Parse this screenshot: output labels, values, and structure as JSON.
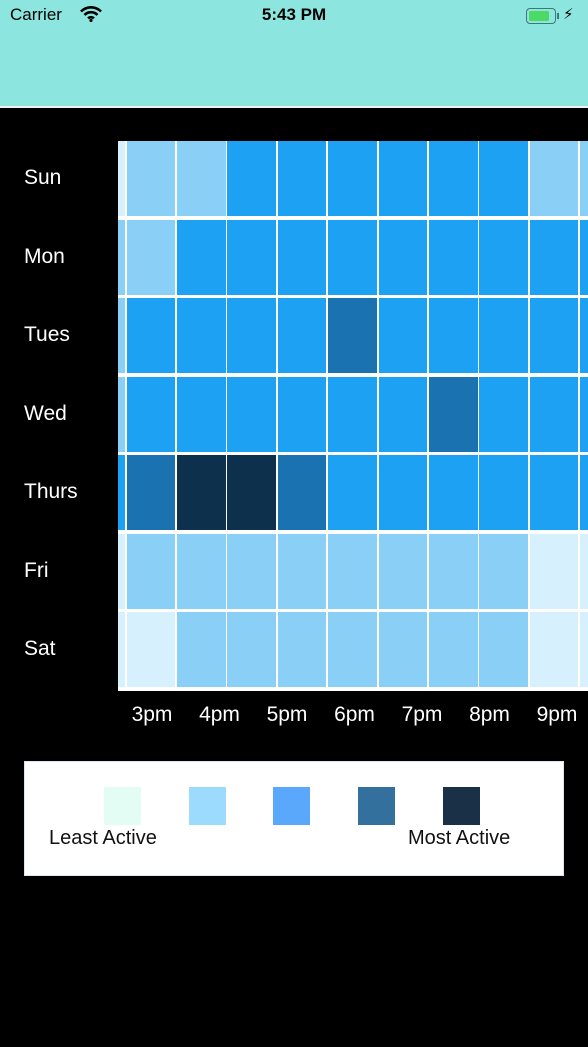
{
  "status_bar": {
    "carrier": "Carrier",
    "time": "5:43 PM",
    "battery_level_percent": 85,
    "charging": true,
    "icons": [
      "wifi-icon",
      "battery-icon",
      "charging-bolt-icon"
    ]
  },
  "header": {
    "background": "#8ce6df"
  },
  "chart_data": {
    "type": "heatmap",
    "rows": [
      "Sun",
      "Mon",
      "Tues",
      "Wed",
      "Thurs",
      "Fri",
      "Sat"
    ],
    "x_tick_labels": [
      "3pm",
      "4pm",
      "5pm",
      "6pm",
      "7pm",
      "8pm",
      "9pm"
    ],
    "levels": [
      [
        0,
        1,
        1,
        2,
        2,
        2,
        2,
        2,
        2,
        1,
        1
      ],
      [
        1,
        1,
        2,
        2,
        2,
        2,
        2,
        2,
        2,
        2,
        2
      ],
      [
        1,
        2,
        2,
        2,
        2,
        3,
        2,
        2,
        2,
        2,
        2
      ],
      [
        1,
        2,
        2,
        2,
        2,
        2,
        2,
        3,
        2,
        2,
        2
      ],
      [
        2,
        3,
        4,
        4,
        3,
        2,
        2,
        2,
        2,
        2,
        2
      ],
      [
        0,
        1,
        1,
        1,
        1,
        1,
        1,
        1,
        1,
        0,
        0
      ],
      [
        0,
        0,
        1,
        1,
        1,
        1,
        1,
        1,
        1,
        0,
        0
      ]
    ],
    "cell_colors": [
      "#d6f0fd",
      "#8acff5",
      "#1da1f2",
      "#1a73b0",
      "#0d314c"
    ]
  },
  "legend": {
    "least_label": "Least Active",
    "most_label": "Most Active",
    "colors": [
      "#e3fdf4",
      "#9cdbfe",
      "#5aa8fc",
      "#34709e",
      "#193046"
    ]
  }
}
